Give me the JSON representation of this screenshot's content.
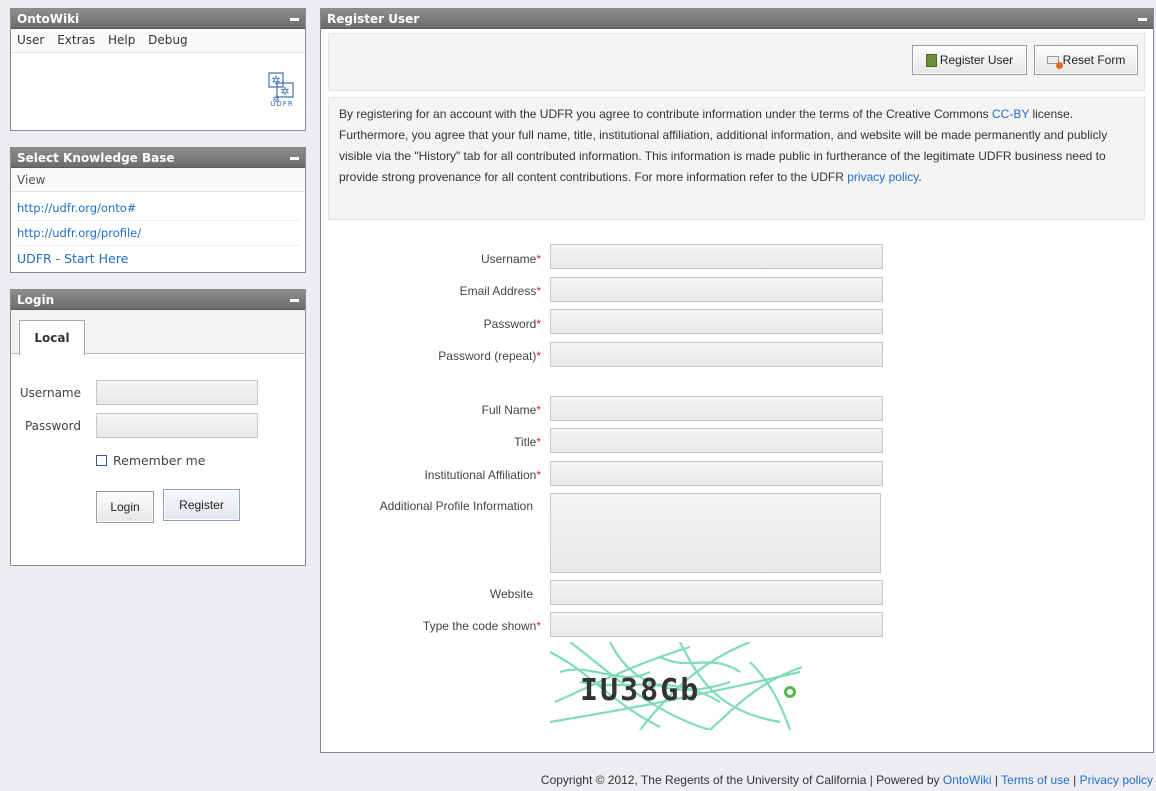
{
  "ontowiki_panel": {
    "title": "OntoWiki",
    "menu": [
      "User",
      "Extras",
      "Help",
      "Debug"
    ],
    "logo_text": "UDFR"
  },
  "kb_panel": {
    "title": "Select Knowledge Base",
    "view_label": "View",
    "items": [
      "http://udfr.org/onto#",
      "http://udfr.org/profile/",
      "UDFR - Start Here"
    ]
  },
  "login_panel": {
    "title": "Login",
    "tab": "Local",
    "username_label": "Username",
    "password_label": "Password",
    "remember_label": "Remember me",
    "login_button": "Login",
    "register_button": "Register"
  },
  "register_panel": {
    "title": "Register User",
    "register_button": "Register User",
    "reset_button": "Reset Form",
    "notice_part1": "By registering for an account with the UDFR you agree to contribute information under the terms of the Creative Commons ",
    "notice_link1": "CC-BY",
    "notice_part2": " license. Furthermore, you agree that your full name, title, institutional affiliation, additional information, and website will be made permanently and publicly visible via the \"History\" tab for all contributed information. This information is made public in furtherance of the legitimate UDFR business need to provide strong provenance for all content contributions. For more information refer to the UDFR ",
    "notice_link2": "privacy policy",
    "notice_end": ".",
    "fields": {
      "username": "Username",
      "email": "Email Address",
      "password": "Password",
      "password_repeat": "Password (repeat)",
      "full_name": "Full Name",
      "title": "Title",
      "affiliation": "Institutional Affiliation",
      "additional": "Additional Profile Information",
      "website": "Website",
      "captcha": "Type the code shown"
    },
    "required_mark": "*",
    "captcha_text": "IU38Gb"
  },
  "footer": {
    "text": "Copyright © 2012, The Regents of the University of California | Powered by ",
    "link_ontowiki": "OntoWiki",
    "sep1": " | ",
    "link_terms": "Terms of use",
    "sep2": " | ",
    "link_privacy": "Privacy policy"
  },
  "colors": {
    "title_bar": "#7a7a7a",
    "link": "#1e6fc9",
    "required": "#dd2222",
    "captcha_lines": "#7fdcb6"
  }
}
